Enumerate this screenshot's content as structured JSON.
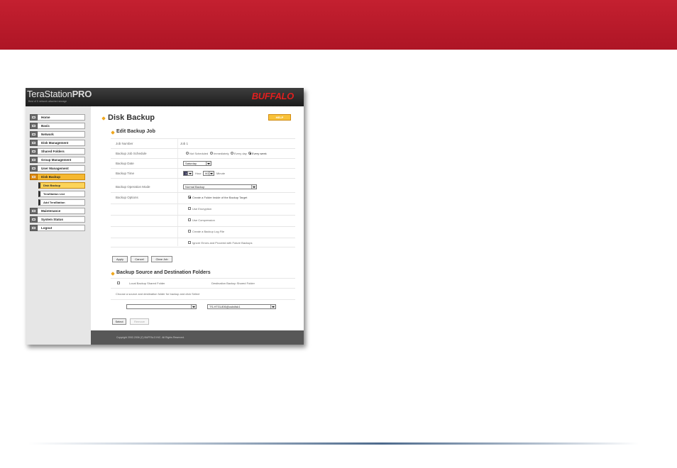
{
  "colors": {
    "banner": "#c01a2b",
    "accent": "#f5b830",
    "brand_red": "#e01f1f"
  },
  "header": {
    "brand_left": "TeraStation",
    "brand_right": "PRO",
    "tagline": "Best of 5 network attached storage",
    "logo": "BUFFALO"
  },
  "sidebar": {
    "items": [
      {
        "label": "Home",
        "icon": "home-icon"
      },
      {
        "label": "Basic",
        "icon": "basic-icon"
      },
      {
        "label": "Network",
        "icon": "network-icon"
      },
      {
        "label": "Disk Management",
        "icon": "disk-icon"
      },
      {
        "label": "Shared Folders",
        "icon": "folder-icon"
      },
      {
        "label": "Group Management",
        "icon": "group-icon"
      },
      {
        "label": "User Management",
        "icon": "user-icon"
      },
      {
        "label": "Disk Backup",
        "icon": "backup-icon"
      },
      {
        "label": "Maintenance",
        "icon": "maintenance-icon"
      },
      {
        "label": "System Status",
        "icon": "status-icon"
      },
      {
        "label": "Logout",
        "icon": "logout-icon"
      }
    ],
    "subitems": [
      "Disk Backup",
      "TeraStation List",
      "Add TeraStation"
    ]
  },
  "main": {
    "title": "Disk Backup",
    "help_label": "HELP",
    "edit_title": "Edit Backup Job",
    "job_number_label": "Job Number",
    "job_number_value": "Job 1",
    "schedule_label": "Backup Job Schedule",
    "schedule_options": [
      "Not Scheduled",
      "Immediately",
      "Every day",
      "Every week"
    ],
    "date_label": "Backup Date",
    "date_value": "Saturday",
    "time_label": "Backup Time",
    "time_hour_value": "1",
    "time_hour_label": "Hour",
    "time_minute_value": "00",
    "time_minute_label": "Minute",
    "mode_label": "Backup Operation Mode",
    "mode_value": "Normal Backup",
    "options_label": "Backup Options",
    "options": [
      {
        "label": "Create a Folder Inside of the Backup Target",
        "checked": true
      },
      {
        "label": "Use Encryption",
        "checked": false
      },
      {
        "label": "Use Compression",
        "checked": false
      },
      {
        "label": "Create a Backup Log File",
        "checked": false
      },
      {
        "label": "Ignore Errors and Proceed with Future Backups",
        "checked": false
      }
    ],
    "apply_label": "Apply",
    "cancel_label": "Cancel",
    "clear_label": "Clear Job",
    "source_title": "Backup Source and Destination Folders",
    "col_local": "Local Backup Shared Folder",
    "col_dest": "Destination Backup Shared Folder",
    "instruction": "Choose a source and destination folder for backup and click Select",
    "source_value": "",
    "dest_value": "TS-HTGL806@usbdisk1",
    "select_label": "Select",
    "remove_label": "Remove",
    "copyright": "Copyright 2002-2006 (C) BUFFALO INC. All Rights Reserved."
  }
}
